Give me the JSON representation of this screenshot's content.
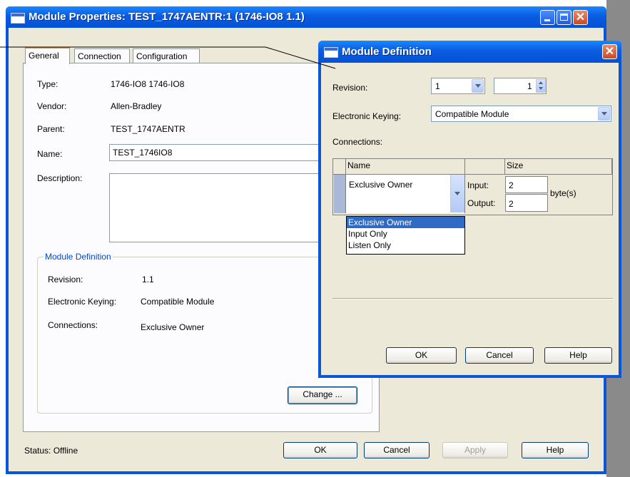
{
  "main_window": {
    "title": "Module Properties: TEST_1747AENTR:1 (1746-IO8 1.1)",
    "tabs": [
      "General",
      "Connection",
      "Configuration"
    ],
    "general": {
      "type_label": "Type:",
      "type_value": "1746-IO8 1746-IO8",
      "vendor_label": "Vendor:",
      "vendor_value": "Allen-Bradley",
      "parent_label": "Parent:",
      "parent_value": "TEST_1747AENTR",
      "name_label": "Name:",
      "name_value": "TEST_1746IO8",
      "description_label": "Description:",
      "description_value": ""
    },
    "module_definition_group": {
      "title": "Module Definition",
      "revision_label": "Revision:",
      "revision_value": "1.1",
      "keying_label": "Electronic Keying:",
      "keying_value": "Compatible Module",
      "connections_label": "Connections:",
      "connections_value": "Exclusive Owner",
      "change_button": "Change ..."
    },
    "status": "Status:  Offline",
    "buttons": {
      "ok": "OK",
      "cancel": "Cancel",
      "apply": "Apply",
      "help": "Help"
    }
  },
  "module_definition_dialog": {
    "title": "Module Definition",
    "revision_label": "Revision:",
    "revision_major": "1",
    "revision_minor": "1",
    "keying_label": "Electronic Keying:",
    "keying_value": "Compatible Module",
    "connections_label": "Connections:",
    "grid_headers": {
      "name": "Name",
      "size": "Size"
    },
    "connection_name": "Exclusive Owner",
    "input_label": "Input:",
    "input_value": "2",
    "output_label": "Output:",
    "output_value": "2",
    "size_unit": "byte(s)",
    "dropdown_options": [
      "Exclusive Owner",
      "Input Only",
      "Listen Only"
    ],
    "dropdown_selected": "Exclusive Owner",
    "buttons": {
      "ok": "OK",
      "cancel": "Cancel",
      "help": "Help"
    }
  },
  "colors": {
    "title_bar": "#0a56d9",
    "dialog_face": "#ece9d8",
    "selection": "#316ac5",
    "group_title": "#0046d5"
  }
}
